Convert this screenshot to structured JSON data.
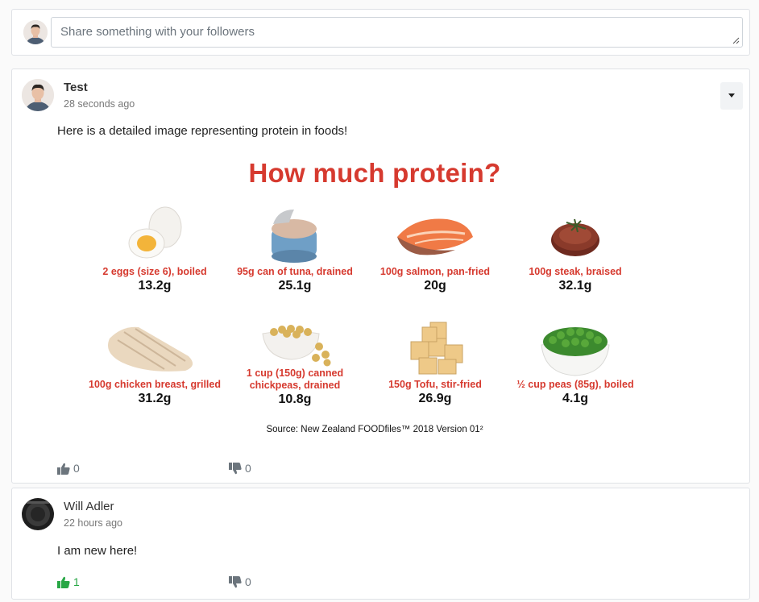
{
  "composer": {
    "placeholder": "Share something with your followers"
  },
  "posts": [
    {
      "author": "Test",
      "time": "28 seconds ago",
      "text": "Here is a detailed image representing protein in foods!",
      "image": {
        "title": "How much protein?",
        "foods": [
          {
            "label": "2 eggs (size 6), boiled",
            "value": "13.2g",
            "icon": "boiled-eggs"
          },
          {
            "label": "95g can of tuna, drained",
            "value": "25.1g",
            "icon": "tuna-can"
          },
          {
            "label": "100g salmon, pan-fried",
            "value": "20g",
            "icon": "salmon-fillet"
          },
          {
            "label": "100g steak, braised",
            "value": "32.1g",
            "icon": "steak"
          },
          {
            "label": "100g chicken breast, grilled",
            "value": "31.2g",
            "icon": "chicken-breast"
          },
          {
            "label_lines": [
              "1 cup (150g) canned",
              "chickpeas, drained"
            ],
            "value": "10.8g",
            "icon": "chickpeas"
          },
          {
            "label": "150g Tofu, stir-fried",
            "value": "26.9g",
            "icon": "tofu"
          },
          {
            "label": "½ cup peas (85g), boiled",
            "value": "4.1g",
            "icon": "peas"
          }
        ],
        "source": "Source: New Zealand FOODfiles™ 2018 Version 01²"
      },
      "likes": "0",
      "dislikes": "0"
    },
    {
      "author": "Will Adler",
      "time": "22 hours ago",
      "text": "I am new here!",
      "likes": "1",
      "dislikes": "0"
    }
  ],
  "colors": {
    "accent_red": "#d63a2f",
    "like_active": "#28a745",
    "muted": "#6c757d"
  }
}
